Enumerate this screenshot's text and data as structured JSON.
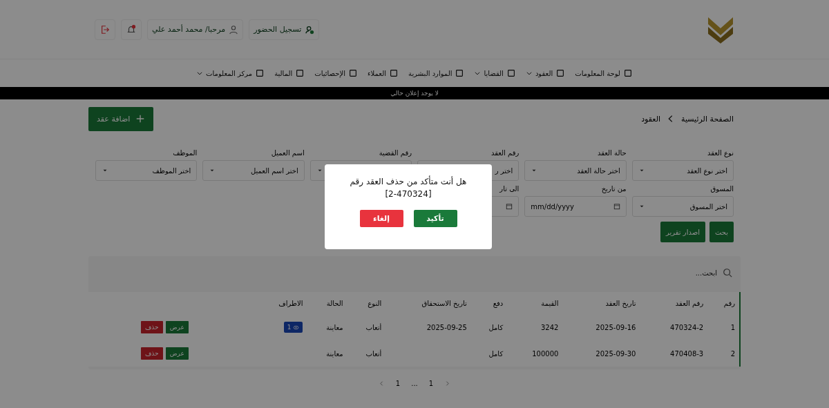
{
  "header": {
    "attendance": "تسجيل الحضور",
    "greeting": "مرحبا/ محمد أحمد علي"
  },
  "nav": [
    {
      "label": "لوحة المعلومات",
      "has_menu": false
    },
    {
      "label": "العقود",
      "has_menu": true
    },
    {
      "label": "القضايا",
      "has_menu": true
    },
    {
      "label": "الموارد البشرية",
      "has_menu": false
    },
    {
      "label": "العملاء",
      "has_menu": false
    },
    {
      "label": "الإحصائيات",
      "has_menu": false
    },
    {
      "label": "المالية",
      "has_menu": false
    },
    {
      "label": "مركز المعلومات",
      "has_menu": true
    }
  ],
  "announcement": "لا يوجد إعلان حالي",
  "breadcrumb": [
    "الصفحة الرئيسية",
    "العقود"
  ],
  "add_button": "اضافة عقد",
  "filters": [
    {
      "label": "نوع العقد",
      "kind": "select",
      "placeholder": "اختر نوع العقد"
    },
    {
      "label": "حالة العقد",
      "kind": "select",
      "placeholder": "اختر حالة العقد"
    },
    {
      "label": "رقم العقد",
      "kind": "text",
      "placeholder": "اختر ر"
    },
    {
      "label": "رقم القضية",
      "kind": "select"
    },
    {
      "label": "اسم العميل",
      "kind": "select",
      "placeholder": "اختر اسم العميل"
    },
    {
      "label": "الموظف",
      "kind": "select",
      "placeholder": "اختر الموظف"
    },
    {
      "label": "المسوق",
      "kind": "select",
      "placeholder": "اختر المسوق"
    },
    {
      "label": "من تاريخ",
      "kind": "date",
      "placeholder": "mm/dd/yyyy"
    },
    {
      "label": "الى تار",
      "kind": "date"
    }
  ],
  "filter_buttons": [
    "بحث",
    "اصدار تقرير"
  ],
  "search": {
    "placeholder": "ابحث..."
  },
  "table": {
    "columns": [
      "رقم",
      "رقم العقد",
      "تاريخ العقد",
      "القيمة",
      "دفع",
      "تاريخ الاستحقاق",
      "النوع",
      "الحالة",
      "الاطراف"
    ],
    "rows": [
      {
        "cells": [
          "1",
          "470324-2",
          "2025-09-16",
          "3242",
          "كامل",
          "2025-09-25",
          "أتعاب",
          "معاينة"
        ],
        "parties": "1",
        "view": "عرض",
        "delete": "حذف"
      },
      {
        "cells": [
          "2",
          "470408-3",
          "2025-09-30",
          "100000",
          "كامل",
          "",
          "أتعاب",
          "معاينة"
        ],
        "view": "عرض",
        "delete": "حذف"
      }
    ]
  },
  "pagination": [
    "1",
    "...",
    "1"
  ],
  "dialog": {
    "message": "هل أنت متأكد من حذف العقد رقم",
    "contract": "[2-470324]",
    "confirm": "تأكيد",
    "cancel": "إلغاء"
  }
}
